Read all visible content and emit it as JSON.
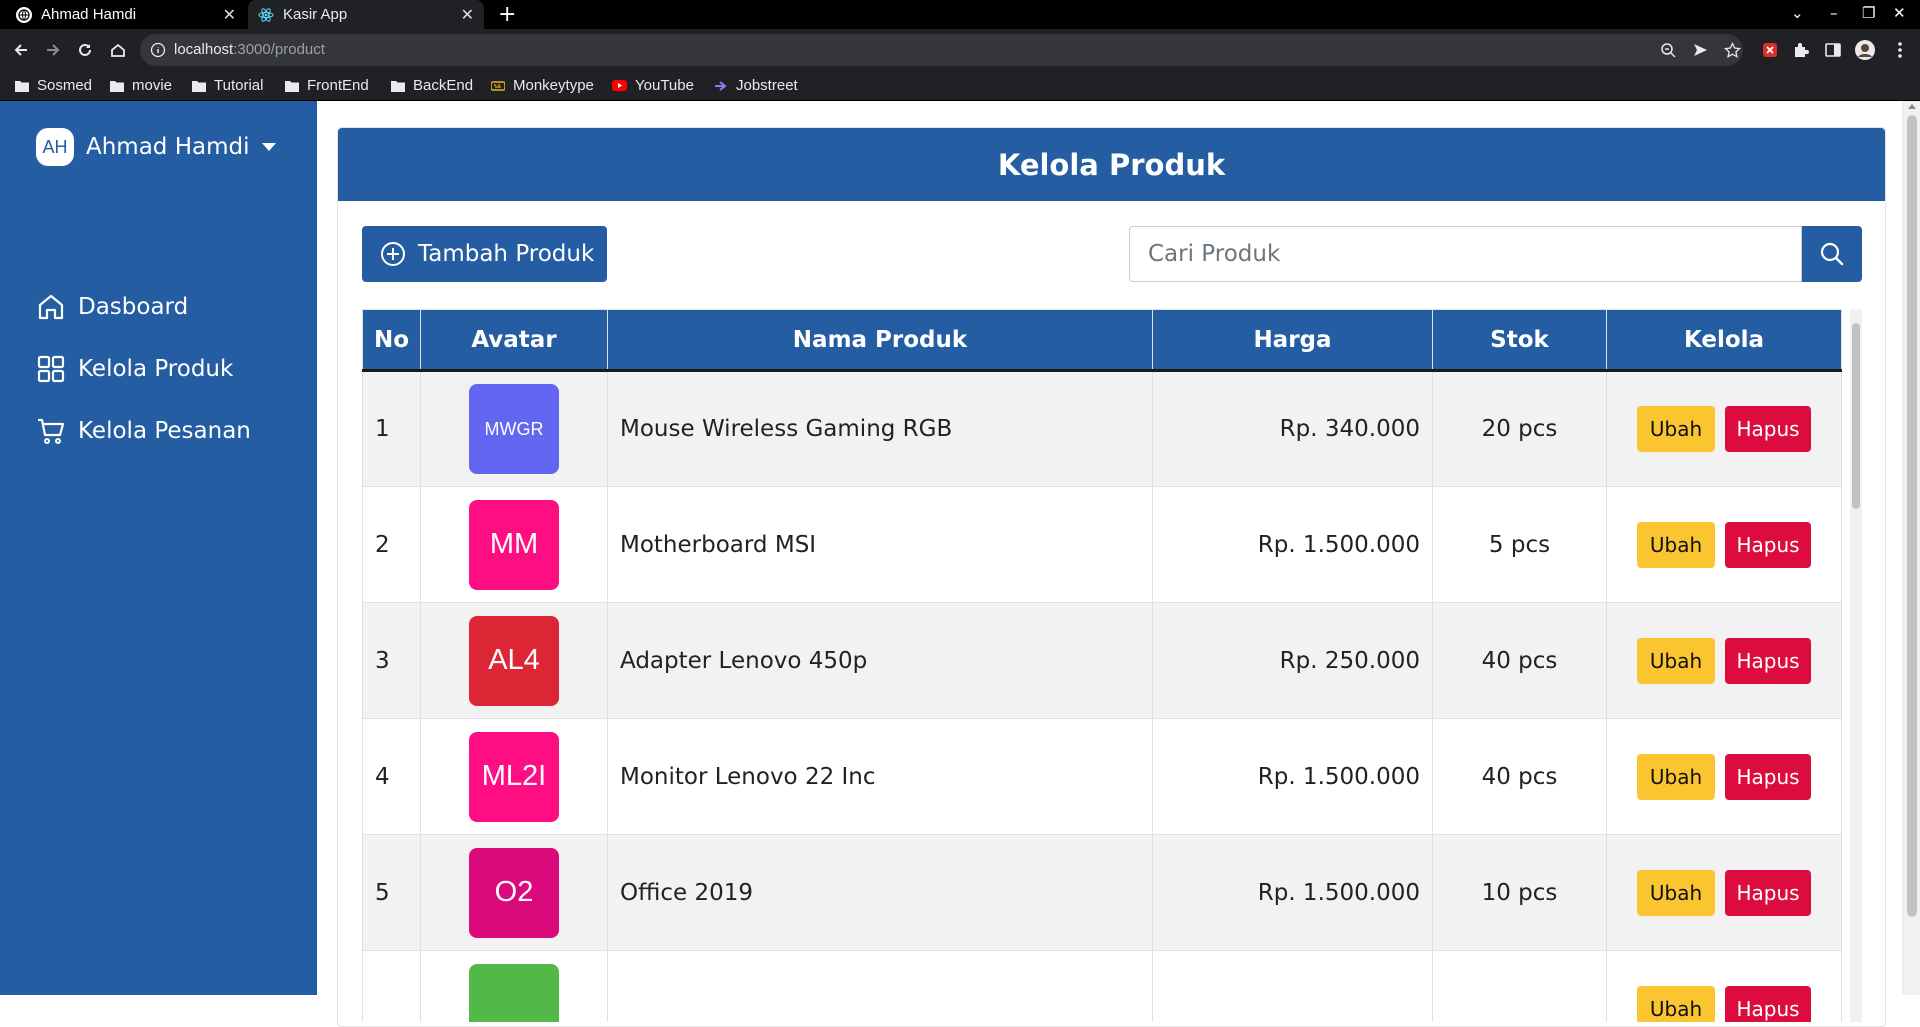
{
  "browser": {
    "tabs": [
      {
        "title": "Ahmad Hamdi",
        "active": false
      },
      {
        "title": "Kasir App",
        "active": true
      }
    ],
    "url_host": "localhost",
    "url_rest": ":3000/product",
    "bookmarks": [
      {
        "label": "Sosmed",
        "icon": "folder-icon"
      },
      {
        "label": "movie",
        "icon": "folder-icon"
      },
      {
        "label": "Tutorial",
        "icon": "folder-icon"
      },
      {
        "label": "FrontEnd",
        "icon": "folder-icon"
      },
      {
        "label": "BackEnd",
        "icon": "folder-icon"
      },
      {
        "label": "Monkeytype",
        "icon": "monkeytype-icon"
      },
      {
        "label": "YouTube",
        "icon": "youtube-icon"
      },
      {
        "label": "Jobstreet",
        "icon": "jobstreet-icon"
      }
    ]
  },
  "sidebar": {
    "profile": {
      "initials": "AH",
      "name": "Ahmad Hamdi"
    },
    "items": [
      {
        "label": "Dasboard",
        "icon": "home-icon"
      },
      {
        "label": "Kelola Produk",
        "icon": "grid-icon"
      },
      {
        "label": "Kelola Pesanan",
        "icon": "cart-icon"
      }
    ]
  },
  "main": {
    "title": "Kelola Produk",
    "add_button": "Tambah Produk",
    "search_placeholder": "Cari Produk",
    "table": {
      "headers": [
        "No",
        "Avatar",
        "Nama Produk",
        "Harga",
        "Stok",
        "Kelola"
      ],
      "rows": [
        {
          "no": "1",
          "avatar": "MWGR",
          "avatar_color": "#6366f1",
          "name": "Mouse Wireless Gaming RGB",
          "price": "Rp. 340.000",
          "stock": "20 pcs"
        },
        {
          "no": "2",
          "avatar": "MM",
          "avatar_color": "#ff0d82",
          "name": "Motherboard MSI",
          "price": "Rp. 1.500.000",
          "stock": "5 pcs"
        },
        {
          "no": "3",
          "avatar": "AL4",
          "avatar_color": "#dc2636",
          "name": "Adapter Lenovo 450p",
          "price": "Rp. 250.000",
          "stock": "40 pcs"
        },
        {
          "no": "4",
          "avatar": "ML2I",
          "avatar_color": "#ff0d82",
          "name": "Monitor Lenovo 22 Inc",
          "price": "Rp. 1.500.000",
          "stock": "40 pcs"
        },
        {
          "no": "5",
          "avatar": "O2",
          "avatar_color": "#db0a7c",
          "name": "Office 2019",
          "price": "Rp. 1.500.000",
          "stock": "10 pcs"
        },
        {
          "no": "",
          "avatar": "",
          "avatar_color": "#52b848",
          "name": "",
          "price": "",
          "stock": ""
        }
      ],
      "edit_label": "Ubah",
      "delete_label": "Hapus"
    }
  },
  "colors": {
    "primary": "#245da1",
    "edit": "#fbc531",
    "delete": "#dc0d3e"
  }
}
